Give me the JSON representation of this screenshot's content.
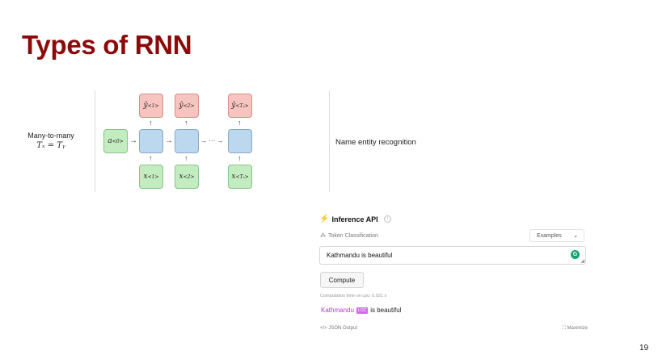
{
  "slide": {
    "title": "Types of RNN",
    "left_label": "Many-to-many",
    "left_math": "Tₓ = Tᵧ",
    "right_label": "Name entity recognition",
    "page_number": "19"
  },
  "diagram": {
    "outputs": [
      {
        "base": "ŷ",
        "sup": "<1>"
      },
      {
        "base": "ŷ",
        "sup": "<2>"
      },
      {
        "base": "ŷ",
        "sup": "<Tᵧ>"
      }
    ],
    "inputs": [
      {
        "base": "x",
        "sup": "<1>"
      },
      {
        "base": "x",
        "sup": "<2>"
      },
      {
        "base": "x",
        "sup": "<Tₓ>"
      }
    ],
    "initial": {
      "base": "a",
      "sup": "<0>"
    },
    "ellipsis": "→ ··· →"
  },
  "inference": {
    "header": "Inference API",
    "task": "Token Classification",
    "examples_label": "Examples",
    "input_value": "Kathmandu is beautiful",
    "compute_label": "Compute",
    "computation_time": "Computation time on cpu: 0.021 s",
    "result_entity": "Kathmandu",
    "result_tag": "LOC",
    "result_rest": "is beautiful",
    "json_output": "JSON Output",
    "maximize": "Maximize"
  },
  "colors": {
    "title": "#8b0a0a",
    "output_box": "#f8c4bf",
    "hidden_box": "#bcd8ee",
    "input_box": "#c3ecc1",
    "entity_tag": "#d667ef"
  }
}
